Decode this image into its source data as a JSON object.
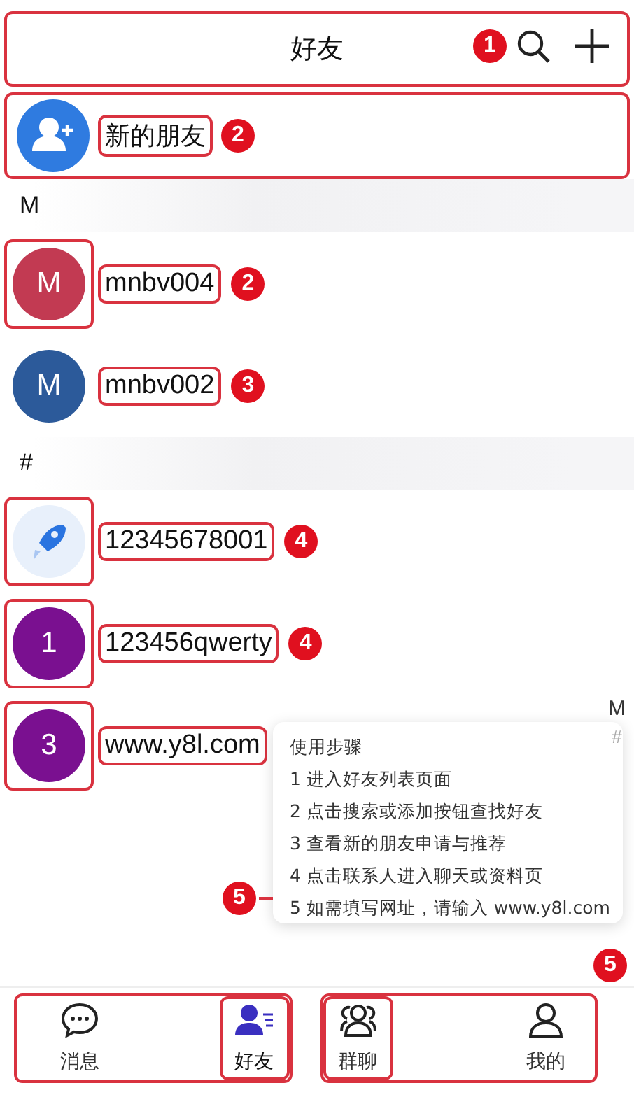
{
  "header": {
    "title": "好友",
    "annotation": "1"
  },
  "new_friend": {
    "label": "新的朋友",
    "annotation": "2"
  },
  "sections": [
    {
      "letter": "M",
      "contacts": [
        {
          "name": "mnbv004",
          "avatar": {
            "kind": "letter",
            "text": "M",
            "color": "#c23a52"
          },
          "avatar_outlined": true,
          "annotation": "2"
        },
        {
          "name": "mnbv002",
          "avatar": {
            "kind": "letter",
            "text": "M",
            "color": "#2c5a9a"
          },
          "avatar_outlined": false,
          "annotation": "3"
        }
      ]
    },
    {
      "letter": "#",
      "contacts": [
        {
          "name": "12345678001",
          "avatar": {
            "kind": "rocket"
          },
          "avatar_outlined": true,
          "annotation": "4"
        },
        {
          "name": "123456qwerty",
          "avatar": {
            "kind": "letter",
            "text": "1",
            "color": "#7a1090"
          },
          "avatar_outlined": true,
          "annotation": "4"
        },
        {
          "name": "www.y8l.com",
          "avatar": {
            "kind": "letter",
            "text": "3",
            "color": "#7a1090"
          },
          "avatar_outlined": true
        }
      ]
    }
  ],
  "index_bar": [
    "M",
    "#"
  ],
  "popup": {
    "title": "使用步骤",
    "steps": [
      "1 进入好友列表页面",
      "2 点击搜索或添加按钮查找好友",
      "3 查看新的朋友申请与推荐",
      "4 点击联系人进入聊天或资料页",
      "5 如需填写网址，请输入 www.y8l.com"
    ],
    "annotation": "5"
  },
  "corner_annotation": "5",
  "tab_groups": [
    [
      {
        "label": "消息",
        "kind": "chat",
        "selected": false,
        "outlined": false
      },
      {
        "label": "好友",
        "kind": "contacts",
        "selected": true,
        "outlined": true
      }
    ],
    [
      {
        "label": "群聊",
        "kind": "group",
        "selected": false,
        "outlined": true
      },
      {
        "label": "我的",
        "kind": "person",
        "selected": false,
        "outlined": false
      }
    ]
  ]
}
